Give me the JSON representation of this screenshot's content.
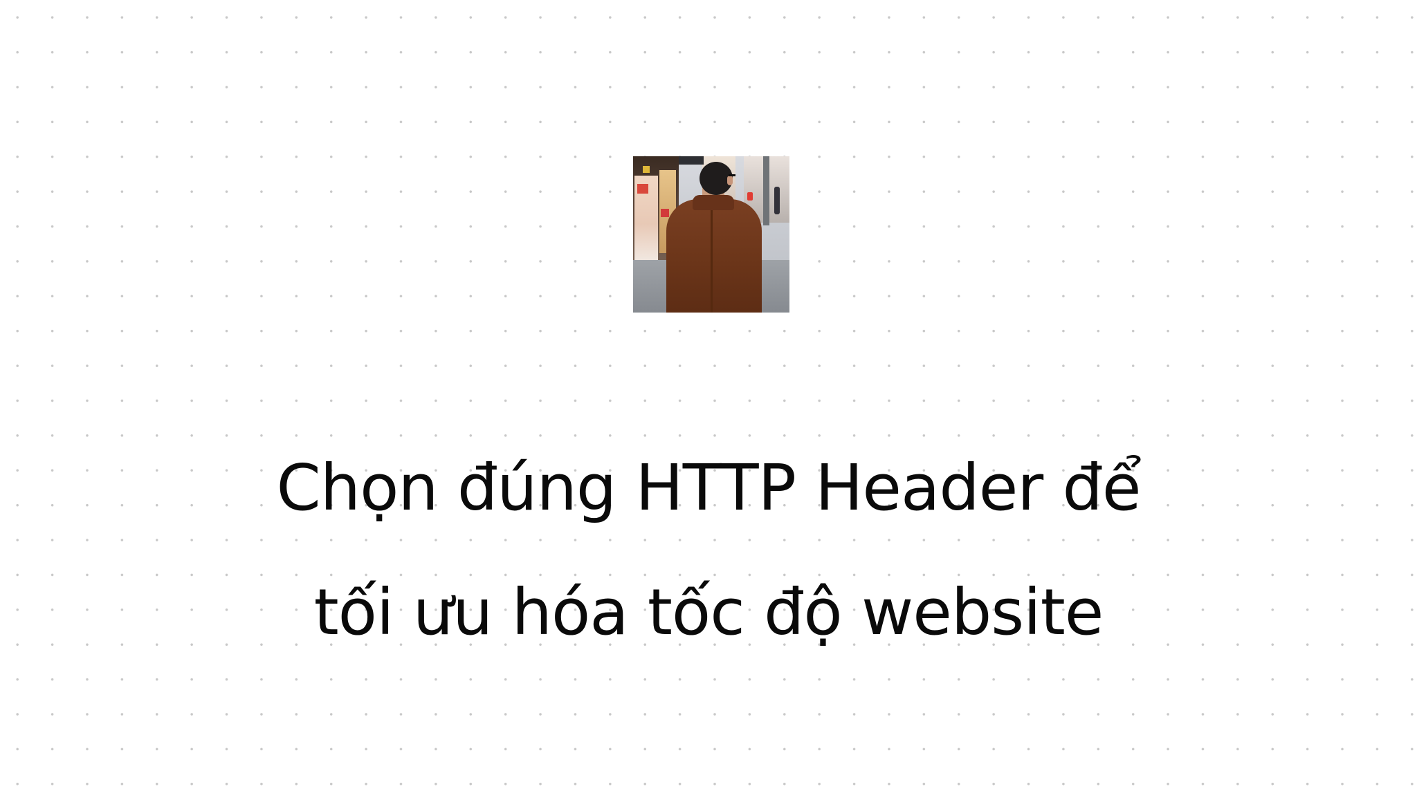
{
  "title": {
    "line1": "Chọn đúng HTTP Header để",
    "line2": "tối ưu hóa tốc độ website"
  },
  "colors": {
    "background": "#ffffff",
    "dot_grid": "#c8c8c8",
    "title_text": "#0a0a0a"
  },
  "icons": {
    "avatar": "author-photo"
  }
}
